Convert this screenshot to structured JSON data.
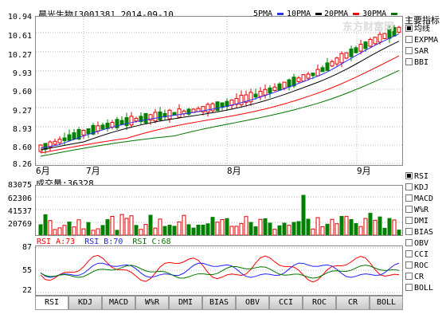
{
  "header": {
    "stock_title": "晨光生物[300138] 2014-09-10",
    "ma_legend": [
      {
        "label": "5PMA",
        "color": "#2d2dff"
      },
      {
        "label": "10PMA",
        "color": "#000000"
      },
      {
        "label": "20PMA",
        "color": "#ff0000"
      },
      {
        "label": "30PMA",
        "color": "#007700"
      }
    ]
  },
  "price_axis": [
    "10.94",
    "10.61",
    "10.27",
    "9.93",
    "9.60",
    "9.27",
    "8.93",
    "8.60",
    "8.26"
  ],
  "month_labels": [
    "6月",
    "7月",
    "8月",
    "9月"
  ],
  "right_panel_top": {
    "title": "主要指标",
    "items": [
      {
        "label": "均线",
        "checked": true
      },
      {
        "label": "EXPMA",
        "checked": false
      },
      {
        "label": "SAR",
        "checked": false
      },
      {
        "label": "BBI",
        "checked": false
      }
    ]
  },
  "right_panel_bottom": {
    "items": [
      {
        "label": "RSI",
        "checked": true
      },
      {
        "label": "KDJ",
        "checked": false
      },
      {
        "label": "MACD",
        "checked": false
      },
      {
        "label": "W%R",
        "checked": false
      },
      {
        "label": "DMI",
        "checked": false
      },
      {
        "label": "BIAS",
        "checked": false
      },
      {
        "label": "OBV",
        "checked": false
      },
      {
        "label": "CCI",
        "checked": false
      },
      {
        "label": "ROC",
        "checked": false
      },
      {
        "label": "CR",
        "checked": false
      },
      {
        "label": "BOLL",
        "checked": false
      }
    ]
  },
  "volume": {
    "label": "成交量:36328",
    "axis": [
      "83075",
      "62306",
      "41537",
      "20769"
    ]
  },
  "rsi": {
    "legend": [
      {
        "label": "RSI_A:73",
        "color": "#ff0000"
      },
      {
        "label": "RSI_B:70",
        "color": "#2020ff"
      },
      {
        "label": "RSI_C:68",
        "color": "#007700"
      }
    ],
    "axis": [
      "87",
      "55",
      "22"
    ]
  },
  "tabs": [
    "RSI",
    "KDJ",
    "MACD",
    "W%R",
    "DMI",
    "BIAS",
    "OBV",
    "CCI",
    "ROC",
    "CR",
    "BOLL"
  ],
  "watermark": "东方财富网",
  "colors": {
    "up": "#e00000",
    "down": "#008000"
  }
}
